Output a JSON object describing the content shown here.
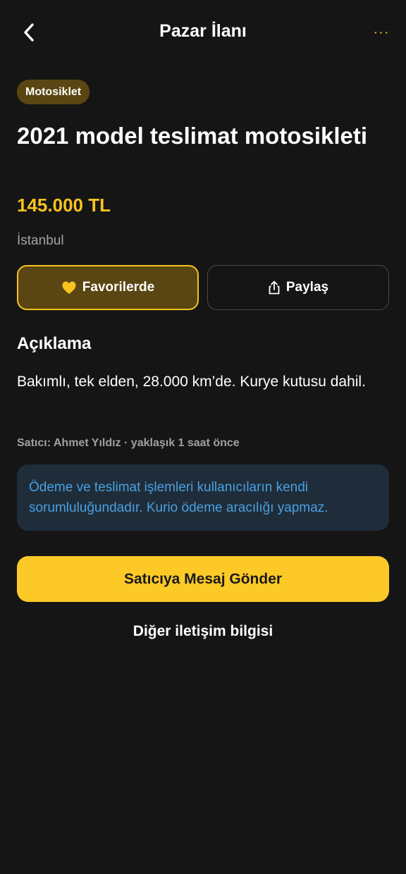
{
  "header": {
    "title": "Pazar İlanı",
    "back_icon": "chevron-left-icon",
    "more_label": "···",
    "more_icon": "more-horizontal-icon"
  },
  "listing": {
    "category": "Motosiklet",
    "title": "2021 model teslimat motosikleti",
    "price": "145.000 TL",
    "location": "İstanbul"
  },
  "actions": {
    "favorite_label": "Favorilerde",
    "favorite_icon": "heart-icon",
    "share_label": "Paylaş",
    "share_icon": "share-icon"
  },
  "description": {
    "heading": "Açıklama",
    "text": "Bakımlı, tek elden, 28.000 km’de. Kurye kutusu dahil."
  },
  "seller_meta": "Satıcı: Ahmet Yıldız · yaklaşık 1 saat önce",
  "notice": "Ödeme ve teslimat işlemleri kullanıcıların kendi sorumluluğundadır. Kurio ödeme aracılığı yapmaz.",
  "cta": {
    "message_label": "Satıcıya Mesaj Gönder",
    "contact_label": "Diğer iletişim bilgisi"
  },
  "colors": {
    "background": "#151515",
    "accent": "#f6c31f",
    "badge_bg": "#5a4612",
    "notice_bg": "#1f2d3a",
    "notice_text": "#4a9fe0"
  }
}
